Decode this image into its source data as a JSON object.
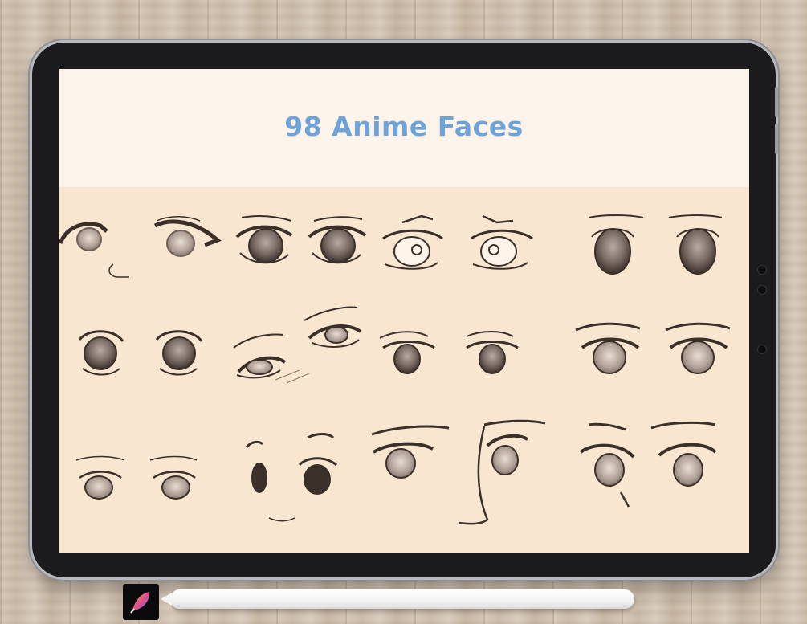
{
  "screen": {
    "title": "98 Anime Faces"
  },
  "colors": {
    "title": "#6fa3d6",
    "banner": "#fcf3ea",
    "canvas": "#f9e6d0",
    "ink": "#3b2f2a",
    "iris": "#6f6159",
    "iris_light": "#b7aba2",
    "tablet_bezel": "#1b1b1d"
  },
  "icons": {
    "app": "procreate-app-icon",
    "stylus": "stylus-pencil"
  }
}
